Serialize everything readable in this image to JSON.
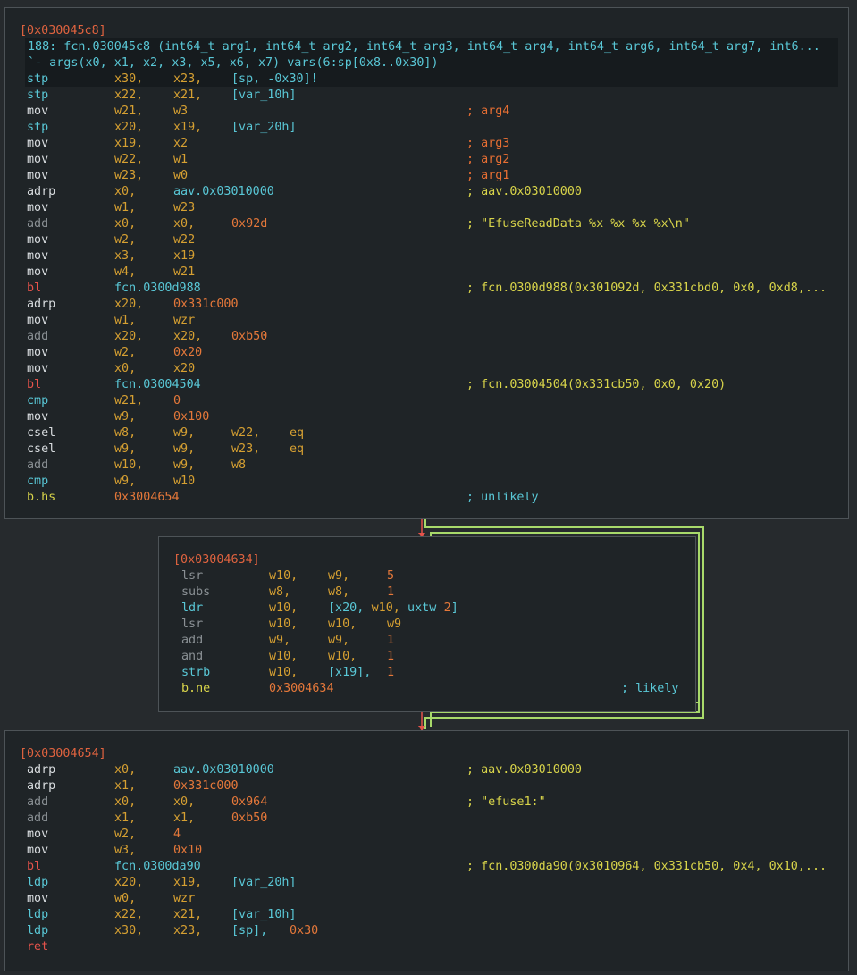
{
  "colors": {
    "background": "#262a2d",
    "block_bg": "#1f2427",
    "border": "#4d5357",
    "header": "#e0633f",
    "fn_sig": "#59c7d6",
    "register": "#d6a032",
    "immediate": "#e5783a",
    "comment": "#d8d44a",
    "comment_arg": "#e86f33",
    "edge_true": "#a8d96a",
    "edge_false": "#e5534b"
  },
  "block1": {
    "header": "[0x030045c8]",
    "signature": "188: fcn.030045c8 (int64_t arg1, int64_t arg2, int64_t arg3, int64_t arg4, int64_t arg6, int64_t arg7, int6...",
    "args": "`- args(x0, x1, x2, x3, x5, x6, x7) vars(6:sp[0x8..0x30])",
    "rows": [
      {
        "m": "stp",
        "mc": "cyan",
        "ops": [
          [
            "x30,",
            "reg"
          ],
          [
            "x23,",
            "reg"
          ],
          [
            "[sp, -0x30]!",
            "mem"
          ]
        ],
        "c": ""
      },
      {
        "m": "stp",
        "mc": "cyan",
        "ops": [
          [
            "x22,",
            "reg"
          ],
          [
            "x21,",
            "reg"
          ],
          [
            "[var_10h]",
            "mem"
          ]
        ],
        "c": ""
      },
      {
        "m": "mov",
        "mc": "white",
        "ops": [
          [
            "w21,",
            "reg"
          ],
          [
            "w3",
            "reg"
          ]
        ],
        "c": "; arg4",
        "cc": "arg"
      },
      {
        "m": "stp",
        "mc": "cyan",
        "ops": [
          [
            "x20,",
            "reg"
          ],
          [
            "x19,",
            "reg"
          ],
          [
            "[var_20h]",
            "mem"
          ]
        ],
        "c": ""
      },
      {
        "m": "mov",
        "mc": "white",
        "ops": [
          [
            "x19,",
            "reg"
          ],
          [
            "x2",
            "reg"
          ]
        ],
        "c": "; arg3",
        "cc": "arg"
      },
      {
        "m": "mov",
        "mc": "white",
        "ops": [
          [
            "w22,",
            "reg"
          ],
          [
            "w1",
            "reg"
          ]
        ],
        "c": "; arg2",
        "cc": "arg"
      },
      {
        "m": "mov",
        "mc": "white",
        "ops": [
          [
            "w23,",
            "reg"
          ],
          [
            "w0",
            "reg"
          ]
        ],
        "c": "; arg1",
        "cc": "arg"
      },
      {
        "m": "adrp",
        "mc": "white",
        "ops": [
          [
            "x0,",
            "reg"
          ],
          [
            "aav.0x03010000",
            "sym"
          ]
        ],
        "c": "; aav.0x03010000",
        "cc": "yel"
      },
      {
        "m": "mov",
        "mc": "white",
        "ops": [
          [
            "w1,",
            "reg"
          ],
          [
            "w23",
            "reg"
          ]
        ],
        "c": ""
      },
      {
        "m": "add",
        "mc": "gray",
        "ops": [
          [
            "x0,",
            "reg"
          ],
          [
            "x0,",
            "reg"
          ],
          [
            "0x92d",
            "imm"
          ]
        ],
        "c": "; \"EfuseReadData %x %x %x %x\\n\"",
        "cc": "yel"
      },
      {
        "m": "mov",
        "mc": "white",
        "ops": [
          [
            "w2,",
            "reg"
          ],
          [
            "w22",
            "reg"
          ]
        ],
        "c": ""
      },
      {
        "m": "mov",
        "mc": "white",
        "ops": [
          [
            "x3,",
            "reg"
          ],
          [
            "x19",
            "reg"
          ]
        ],
        "c": ""
      },
      {
        "m": "mov",
        "mc": "white",
        "ops": [
          [
            "w4,",
            "reg"
          ],
          [
            "w21",
            "reg"
          ]
        ],
        "c": ""
      },
      {
        "m": "bl",
        "mc": "red",
        "ops": [
          [
            "fcn.0300d988",
            "sym"
          ]
        ],
        "c": "; fcn.0300d988(0x301092d, 0x331cbd0, 0x0, 0xd8,...",
        "cc": "yel"
      },
      {
        "m": "adrp",
        "mc": "white",
        "ops": [
          [
            "x20,",
            "reg"
          ],
          [
            "0x331c000",
            "imm"
          ]
        ],
        "c": ""
      },
      {
        "m": "mov",
        "mc": "white",
        "ops": [
          [
            "w1,",
            "reg"
          ],
          [
            "wzr",
            "reg"
          ]
        ],
        "c": ""
      },
      {
        "m": "add",
        "mc": "gray",
        "ops": [
          [
            "x20,",
            "reg"
          ],
          [
            "x20,",
            "reg"
          ],
          [
            "0xb50",
            "imm"
          ]
        ],
        "c": ""
      },
      {
        "m": "mov",
        "mc": "white",
        "ops": [
          [
            "w2,",
            "reg"
          ],
          [
            "0x20",
            "imm"
          ]
        ],
        "c": ""
      },
      {
        "m": "mov",
        "mc": "white",
        "ops": [
          [
            "x0,",
            "reg"
          ],
          [
            "x20",
            "reg"
          ]
        ],
        "c": ""
      },
      {
        "m": "bl",
        "mc": "red",
        "ops": [
          [
            "fcn.03004504",
            "sym"
          ]
        ],
        "c": "; fcn.03004504(0x331cb50, 0x0, 0x20)",
        "cc": "yel"
      },
      {
        "m": "cmp",
        "mc": "cyan",
        "ops": [
          [
            "w21,",
            "reg"
          ],
          [
            "0",
            "imm"
          ]
        ],
        "c": ""
      },
      {
        "m": "mov",
        "mc": "white",
        "ops": [
          [
            "w9,",
            "reg"
          ],
          [
            "0x100",
            "imm"
          ]
        ],
        "c": ""
      },
      {
        "m": "csel",
        "mc": "white",
        "ops": [
          [
            "w8,",
            "reg"
          ],
          [
            "w9,",
            "reg"
          ],
          [
            "w22,",
            "reg"
          ],
          [
            "eq",
            "reg"
          ]
        ],
        "c": ""
      },
      {
        "m": "csel",
        "mc": "white",
        "ops": [
          [
            "w9,",
            "reg"
          ],
          [
            "w9,",
            "reg"
          ],
          [
            "w23,",
            "reg"
          ],
          [
            "eq",
            "reg"
          ]
        ],
        "c": ""
      },
      {
        "m": "add",
        "mc": "gray",
        "ops": [
          [
            "w10,",
            "reg"
          ],
          [
            "w9,",
            "reg"
          ],
          [
            "w8",
            "reg"
          ]
        ],
        "c": ""
      },
      {
        "m": "cmp",
        "mc": "cyan",
        "ops": [
          [
            "w9,",
            "reg"
          ],
          [
            "w10",
            "reg"
          ]
        ],
        "c": ""
      },
      {
        "m": "b.hs",
        "mc": "yellow",
        "ops": [
          [
            "0x3004654",
            "imm"
          ]
        ],
        "c": "; unlikely",
        "cc": "cyan"
      }
    ]
  },
  "block2": {
    "header": "[0x03004634]",
    "rows": [
      {
        "m": "lsr",
        "mc": "gray",
        "ops": [
          [
            "w10,",
            "reg"
          ],
          [
            "w9,",
            "reg"
          ],
          [
            "5",
            "imm"
          ]
        ],
        "c": ""
      },
      {
        "m": "subs",
        "mc": "gray",
        "ops": [
          [
            "w8,",
            "reg"
          ],
          [
            "w8,",
            "reg"
          ],
          [
            "1",
            "imm"
          ]
        ],
        "c": ""
      },
      {
        "m": "ldr",
        "mc": "cyan",
        "ops": [
          [
            "w10,",
            "reg"
          ],
          [
            "[x20, ",
            "mem"
          ],
          [
            "w10,",
            "reg"
          ],
          [
            " uxtw ",
            "mem"
          ],
          [
            "2",
            "imm"
          ],
          [
            "]",
            "mem"
          ]
        ],
        "c": ""
      },
      {
        "m": "lsr",
        "mc": "gray",
        "ops": [
          [
            "w10,",
            "reg"
          ],
          [
            "w10,",
            "reg"
          ],
          [
            "w9",
            "reg"
          ]
        ],
        "c": ""
      },
      {
        "m": "add",
        "mc": "gray",
        "ops": [
          [
            "w9,",
            "reg"
          ],
          [
            "w9,",
            "reg"
          ],
          [
            "1",
            "imm"
          ]
        ],
        "c": ""
      },
      {
        "m": "and",
        "mc": "gray",
        "ops": [
          [
            "w10,",
            "reg"
          ],
          [
            "w10,",
            "reg"
          ],
          [
            "1",
            "imm"
          ]
        ],
        "c": ""
      },
      {
        "m": "strb",
        "mc": "cyan",
        "ops": [
          [
            "w10,",
            "reg"
          ],
          [
            "[x19],",
            "mem"
          ],
          [
            "1",
            "imm"
          ]
        ],
        "c": ""
      },
      {
        "m": "b.ne",
        "mc": "yellow",
        "ops": [
          [
            "0x3004634",
            "imm"
          ]
        ],
        "c": "; likely",
        "cc": "cyan"
      }
    ]
  },
  "block3": {
    "header": "[0x03004654]",
    "rows": [
      {
        "m": "adrp",
        "mc": "white",
        "ops": [
          [
            "x0,",
            "reg"
          ],
          [
            "aav.0x03010000",
            "sym"
          ]
        ],
        "c": "; aav.0x03010000",
        "cc": "yel"
      },
      {
        "m": "adrp",
        "mc": "white",
        "ops": [
          [
            "x1,",
            "reg"
          ],
          [
            "0x331c000",
            "imm"
          ]
        ],
        "c": ""
      },
      {
        "m": "add",
        "mc": "gray",
        "ops": [
          [
            "x0,",
            "reg"
          ],
          [
            "x0,",
            "reg"
          ],
          [
            "0x964",
            "imm"
          ]
        ],
        "c": "; \"efuse1:\"",
        "cc": "yel"
      },
      {
        "m": "add",
        "mc": "gray",
        "ops": [
          [
            "x1,",
            "reg"
          ],
          [
            "x1,",
            "reg"
          ],
          [
            "0xb50",
            "imm"
          ]
        ],
        "c": ""
      },
      {
        "m": "mov",
        "mc": "white",
        "ops": [
          [
            "w2,",
            "reg"
          ],
          [
            "4",
            "imm"
          ]
        ],
        "c": ""
      },
      {
        "m": "mov",
        "mc": "white",
        "ops": [
          [
            "w3,",
            "reg"
          ],
          [
            "0x10",
            "imm"
          ]
        ],
        "c": ""
      },
      {
        "m": "bl",
        "mc": "red",
        "ops": [
          [
            "fcn.0300da90",
            "sym"
          ]
        ],
        "c": "; fcn.0300da90(0x3010964, 0x331cb50, 0x4, 0x10,...",
        "cc": "yel"
      },
      {
        "m": "ldp",
        "mc": "cyan",
        "ops": [
          [
            "x20,",
            "reg"
          ],
          [
            "x19,",
            "reg"
          ],
          [
            "[var_20h]",
            "mem"
          ]
        ],
        "c": ""
      },
      {
        "m": "mov",
        "mc": "white",
        "ops": [
          [
            "w0,",
            "reg"
          ],
          [
            "wzr",
            "reg"
          ]
        ],
        "c": ""
      },
      {
        "m": "ldp",
        "mc": "cyan",
        "ops": [
          [
            "x22,",
            "reg"
          ],
          [
            "x21,",
            "reg"
          ],
          [
            "[var_10h]",
            "mem"
          ]
        ],
        "c": ""
      },
      {
        "m": "ldp",
        "mc": "cyan",
        "ops": [
          [
            "x30,",
            "reg"
          ],
          [
            "x23,",
            "reg"
          ],
          [
            "[sp],",
            "mem"
          ],
          [
            "0x30",
            "imm"
          ]
        ],
        "c": ""
      },
      {
        "m": "ret",
        "mc": "red",
        "ops": [],
        "c": ""
      }
    ]
  }
}
